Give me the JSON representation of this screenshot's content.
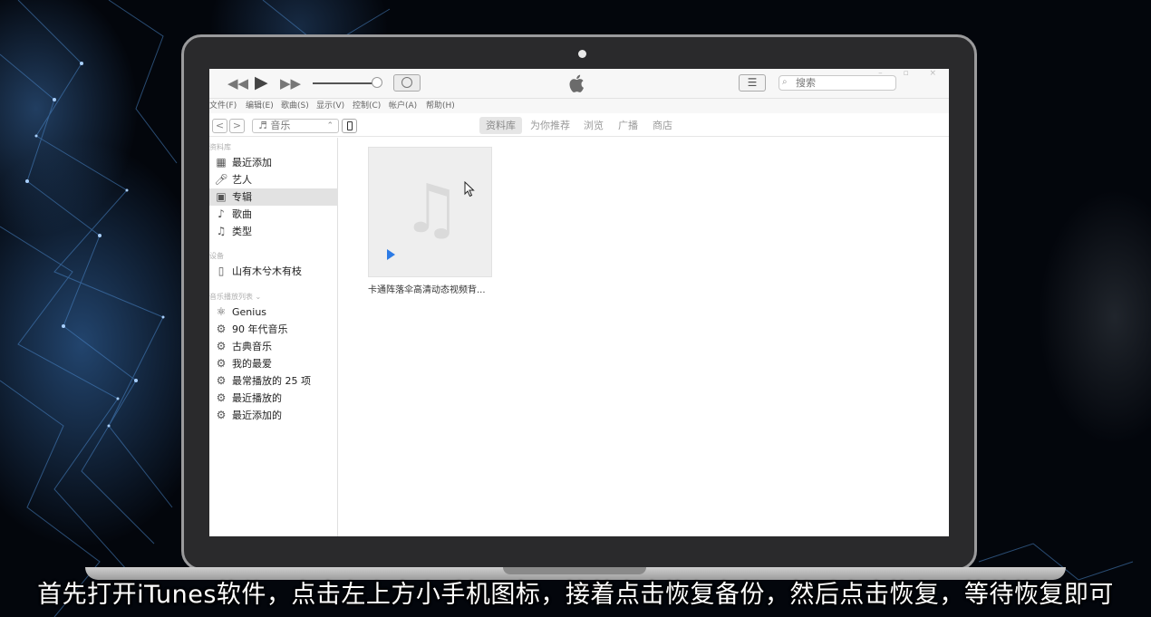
{
  "toolbar": {
    "rewind_icon": "rewind-icon",
    "play_icon": "play-icon",
    "forward_icon": "fast-forward-icon",
    "airplay_icon": "airplay-icon",
    "list_icon": "list-view-icon",
    "search_placeholder": "搜索",
    "window_controls": "–  ▫  ×"
  },
  "menu": [
    "文件(F)",
    "编辑(E)",
    "歌曲(S)",
    "显示(V)",
    "控制(C)",
    "帐户(A)",
    "帮助(H)"
  ],
  "nav": {
    "back": "<",
    "forward": ">",
    "media_type": "♬ 音乐",
    "caret": "⌃",
    "tabs": [
      "资料库",
      "为你推荐",
      "浏览",
      "广播",
      "商店"
    ],
    "active_tab": "资料库"
  },
  "sidebar": {
    "library_header": "资料库",
    "library_items": [
      {
        "label": "最近添加",
        "icon": "calendar-grid-icon"
      },
      {
        "label": "艺人",
        "icon": "microphone-icon"
      },
      {
        "label": "专辑",
        "icon": "album-icon",
        "selected": true
      },
      {
        "label": "歌曲",
        "icon": "music-note-icon"
      },
      {
        "label": "类型",
        "icon": "genre-icon"
      }
    ],
    "devices_header": "设备",
    "device_name": "山有木兮木有枝",
    "playlists_header": "音乐播放列表",
    "playlists": [
      {
        "label": "Genius",
        "icon": "genius-atom-icon"
      },
      {
        "label": "90 年代音乐",
        "icon": "smart-playlist-gear-icon"
      },
      {
        "label": "古典音乐",
        "icon": "smart-playlist-gear-icon"
      },
      {
        "label": "我的最爱",
        "icon": "smart-playlist-gear-icon"
      },
      {
        "label": "最常播放的 25 项",
        "icon": "smart-playlist-gear-icon"
      },
      {
        "label": "最近播放的",
        "icon": "smart-playlist-gear-icon"
      },
      {
        "label": "最近添加的",
        "icon": "smart-playlist-gear-icon"
      }
    ]
  },
  "album": {
    "title": "卡通阵落伞高清动态视频背...",
    "artwork_icon": "music-note-icon"
  },
  "subtitle": "首先打开iTunes软件，点击左上方小手机图标，接着点击恢复备份，然后点击恢复，等待恢复即可",
  "colors": {
    "accent": "#2c7be5",
    "background": "#03060c"
  }
}
